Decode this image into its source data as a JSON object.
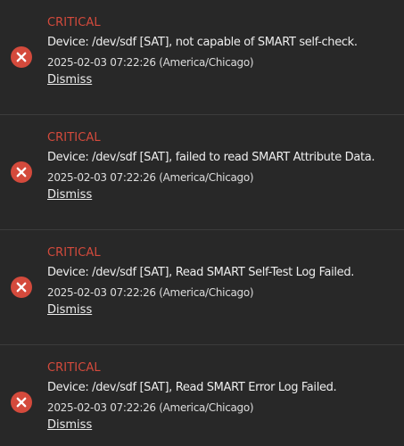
{
  "colors": {
    "background": "#282828",
    "critical": "#d44a3c",
    "text": "#ededed"
  },
  "alerts": [
    {
      "level": "CRITICAL",
      "message": "Device: /dev/sdf [SAT], not capable of SMART self-check.",
      "timestamp": "2025-02-03 07:22:26 (America/Chicago)",
      "dismiss_label": "Dismiss",
      "icon": "error-circle-icon"
    },
    {
      "level": "CRITICAL",
      "message": "Device: /dev/sdf [SAT], failed to read SMART Attribute Data.",
      "timestamp": "2025-02-03 07:22:26 (America/Chicago)",
      "dismiss_label": "Dismiss",
      "icon": "error-circle-icon"
    },
    {
      "level": "CRITICAL",
      "message": "Device: /dev/sdf [SAT], Read SMART Self-Test Log Failed.",
      "timestamp": "2025-02-03 07:22:26 (America/Chicago)",
      "dismiss_label": "Dismiss",
      "icon": "error-circle-icon"
    },
    {
      "level": "CRITICAL",
      "message": "Device: /dev/sdf [SAT], Read SMART Error Log Failed.",
      "timestamp": "2025-02-03 07:22:26 (America/Chicago)",
      "dismiss_label": "Dismiss",
      "icon": "error-circle-icon"
    }
  ]
}
